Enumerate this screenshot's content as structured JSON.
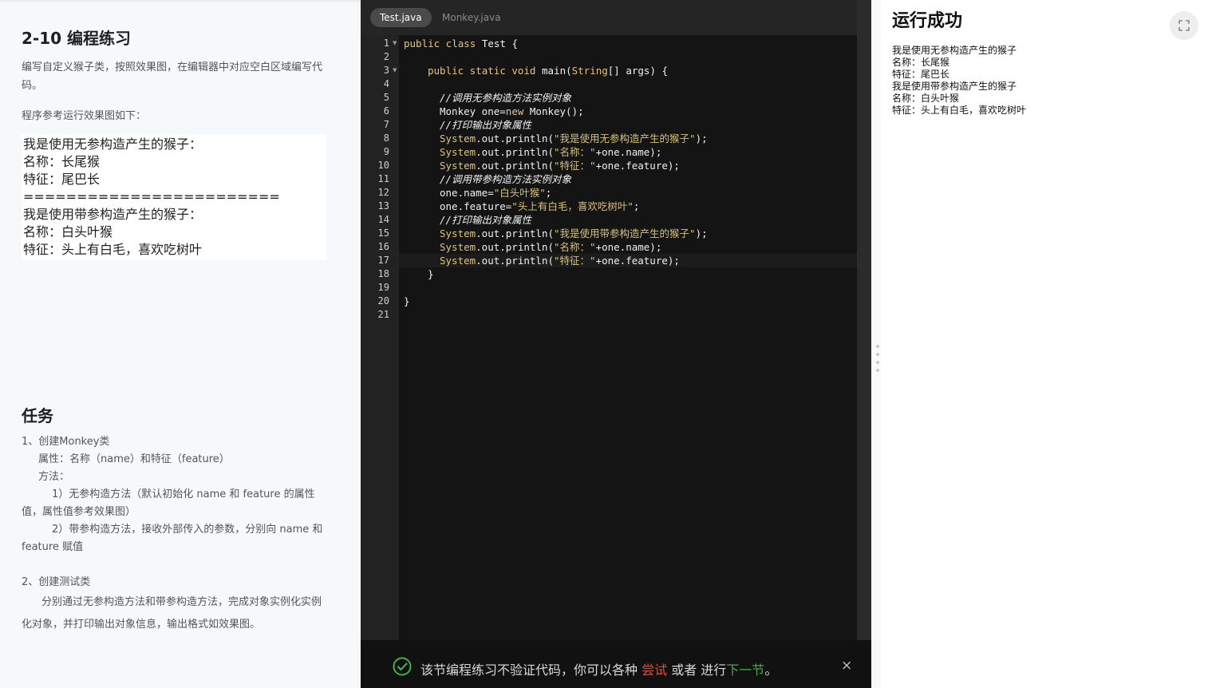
{
  "left": {
    "title": "2-10 编程练习",
    "description": "编写自定义猴子类，按照效果图，在编辑器中对应空白区域编写代码。",
    "reference_text": "程序参考运行效果图如下：",
    "demo_lines": [
      "我是使用无参构造产生的猴子：",
      "名称：长尾猴",
      "特征：尾巴长",
      "========================",
      "我是使用带参构造产生的猴子：",
      "名称：白头叶猴",
      "特征：头上有白毛，喜欢吃树叶"
    ],
    "task_title": "任务",
    "task": {
      "t1": "1、创建Monkey类",
      "t1_attr": "属性：名称（name）和特征（feature）",
      "t1_method": "方法：",
      "t1_m1": "1）无参构造方法（默认初始化 name 和 feature 的属性值，属性值参考效果图）",
      "t1_m2": "2）带参构造方法，接收外部传入的参数，分别向 name 和 feature 赋值",
      "t2": "2、创建测试类",
      "t2_desc": "分别通过无参构造方法和带参构造方法，完成对象实例化实例化对象，并打印输出对象信息，输出格式如效果图。"
    }
  },
  "editor": {
    "tabs": [
      "Test.java",
      "Monkey.java"
    ],
    "active_tab": 0,
    "line_numbers": [
      "1",
      "2",
      "3",
      "4",
      "5",
      "6",
      "7",
      "8",
      "9",
      "10",
      "11",
      "12",
      "13",
      "14",
      "15",
      "16",
      "17",
      "18",
      "19",
      "20",
      "21"
    ],
    "code": {
      "l1_kw": "public class",
      "l1_rest": " Test {",
      "l3_kw": "public static void",
      "l3_rest": " main(",
      "l3_type": "String",
      "l3_end": "[] args) {",
      "l5": "//调用无参构造方法实例对象",
      "l6_a": "Monkey one=",
      "l6_kw": "new",
      "l6_b": " Monkey();",
      "l7": "//打印输出对象属性",
      "sys": "System",
      "println": ".out.println(",
      "l8_str": "\"我是使用无参构造产生的猴子\"",
      "close": ");",
      "l9_str": "\"名称：\"",
      "l9_rest": "+one.name);",
      "l10_str": "\"特征：\"",
      "l10_rest": "+one.feature);",
      "l11": "//调用带参构造方法实例对象",
      "l12_a": "one.name=",
      "l12_str": "\"白头叶猴\"",
      "l12_b": ";",
      "l13_a": "one.feature=",
      "l13_str": "\"头上有白毛，喜欢吃树叶\"",
      "l13_b": ";",
      "l14": "//打印输出对象属性",
      "l15_str": "\"我是使用带参构造产生的猴子\"",
      "l18": "}",
      "l20": "}"
    },
    "footer": {
      "text1": "该节编程练习不验证代码，你可以各种 ",
      "try": "尝试",
      "text2": " 或者 进行",
      "next": "下一节",
      "text3": "。",
      "close": "×"
    }
  },
  "right": {
    "title": "运行成功",
    "output_lines": [
      "我是使用无参构造产生的猴子",
      "名称：长尾猴",
      "特征：尾巴长",
      "我是使用带参构造产生的猴子",
      "名称：白头叶猴",
      "特征：头上有白毛，喜欢吃树叶"
    ]
  },
  "colors": {
    "editor_bg": "#141414",
    "footer_bg": "#111111",
    "try_red": "#e24a3b",
    "next_green": "#3fb04a"
  },
  "icons": [
    "check-circle-icon",
    "close-icon",
    "fullscreen-icon",
    "drag-handle-icon",
    "fold-arrow-icon"
  ]
}
